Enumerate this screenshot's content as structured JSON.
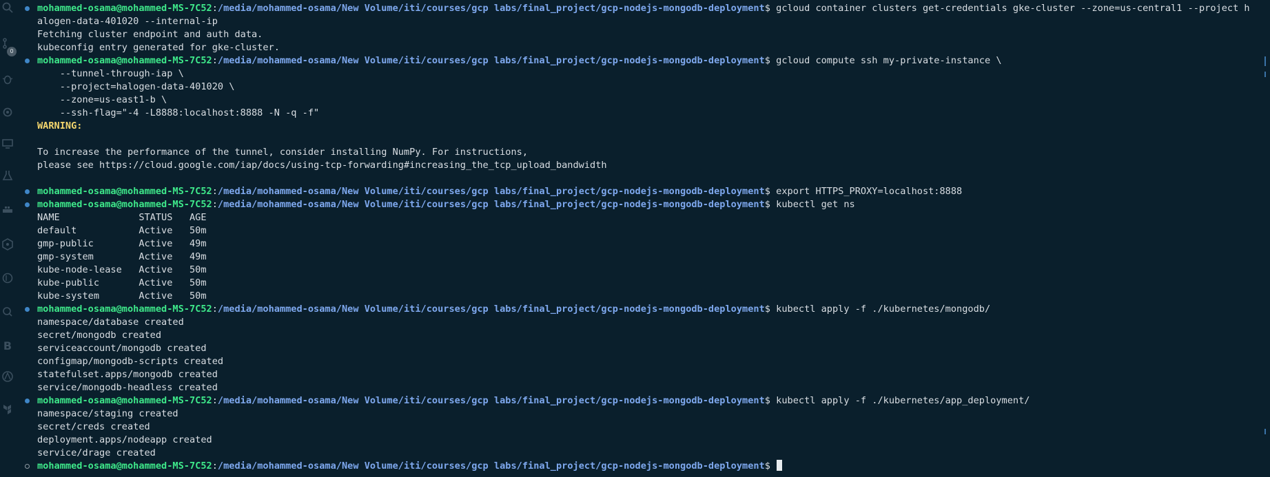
{
  "prompt": {
    "user": "mohammed-osama@mohammed-MS-7C52",
    "sep": ":",
    "path": "/media/mohammed-osama/New Volume/iti/courses/gcp labs/final_project/gcp-nodejs-mongodb-deployment",
    "sigil": "$"
  },
  "activity_bar": {
    "badge": "0",
    "letter": "B"
  },
  "blocks": [
    {
      "command": " gcloud container clusters get-credentials gke-cluster --zone=us-central1 --project h",
      "output": [
        "alogen-data-401020 --internal-ip",
        "Fetching cluster endpoint and auth data.",
        "kubeconfig entry generated for gke-cluster."
      ]
    },
    {
      "command": " gcloud compute ssh my-private-instance \\",
      "output": [
        "    --tunnel-through-iap \\",
        "    --project=halogen-data-401020 \\",
        "    --zone=us-east1-b \\",
        "    --ssh-flag=\"-4 -L8888:localhost:8888 -N -q -f\""
      ],
      "warning": "WARNING:",
      "after_warning": [
        "",
        "To increase the performance of the tunnel, consider installing NumPy. For instructions,",
        "please see https://cloud.google.com/iap/docs/using-tcp-forwarding#increasing_the_tcp_upload_bandwidth",
        ""
      ]
    },
    {
      "command": " export HTTPS_PROXY=localhost:8888",
      "output": []
    },
    {
      "command": " kubectl get ns",
      "output": [
        "NAME              STATUS   AGE",
        "default           Active   50m",
        "gmp-public        Active   49m",
        "gmp-system        Active   49m",
        "kube-node-lease   Active   50m",
        "kube-public       Active   50m",
        "kube-system       Active   50m"
      ]
    },
    {
      "command": " kubectl apply -f ./kubernetes/mongodb/",
      "output": [
        "namespace/database created",
        "secret/mongodb created",
        "serviceaccount/mongodb created",
        "configmap/mongodb-scripts created",
        "statefulset.apps/mongodb created",
        "service/mongodb-headless created"
      ]
    },
    {
      "command": " kubectl apply -f ./kubernetes/app_deployment/",
      "output": [
        "namespace/staging created",
        "secret/creds created",
        "deployment.apps/nodeapp created",
        "service/drage created"
      ]
    },
    {
      "command": " ",
      "output": [],
      "active": true
    }
  ],
  "colors": {
    "background": "#0a1f2c",
    "user": "#3ee88a",
    "path": "#7ea8ee",
    "warning": "#f3d56d",
    "text": "#d9dee3"
  }
}
